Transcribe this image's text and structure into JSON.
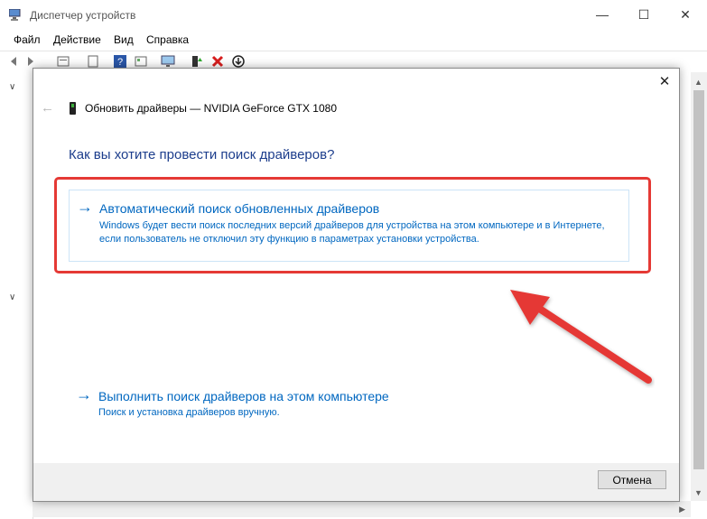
{
  "window": {
    "title": "Диспетчер устройств",
    "controls": {
      "minimize": "—",
      "maximize": "☐",
      "close": "✕"
    }
  },
  "menu": {
    "items": [
      "Файл",
      "Действие",
      "Вид",
      "Справка"
    ]
  },
  "dialog": {
    "close_glyph": "✕",
    "back_glyph": "←",
    "title": "Обновить драйверы — NVIDIA GeForce GTX 1080",
    "question": "Как вы хотите провести поиск драйверов?",
    "options": [
      {
        "arrow": "→",
        "title": "Автоматический поиск обновленных драйверов",
        "description": "Windows будет вести поиск последних версий драйверов для устройства на этом компьютере и в Интернете, если пользователь не отключил эту функцию в параметрах установки устройства."
      },
      {
        "arrow": "→",
        "title": "Выполнить поиск драйверов на этом компьютере",
        "description": "Поиск и установка драйверов вручную."
      }
    ],
    "cancel_label": "Отмена"
  },
  "icons": {
    "app": "device-manager-icon",
    "back": "back-arrow-icon",
    "forward": "forward-arrow-icon",
    "help": "help-icon",
    "update_driver": "update-driver-icon",
    "uninstall": "uninstall-red-x-icon",
    "disable": "disable-device-icon"
  },
  "colors": {
    "link_blue": "#0067c0",
    "heading_blue": "#1c3d8c",
    "annotation_red": "#e53935"
  }
}
